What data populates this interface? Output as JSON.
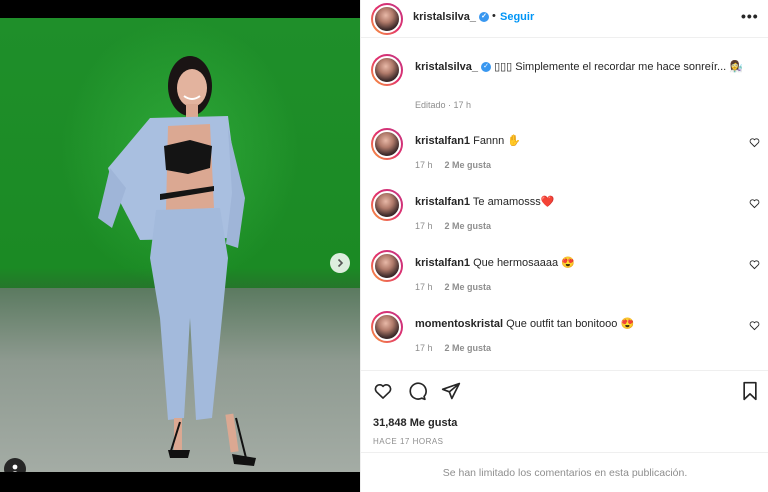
{
  "post": {
    "username": "kristalsilva_",
    "follow_label": "Seguir",
    "dot": "•",
    "more_label": "•••",
    "caption": "▯▯▯ Simplemente el recordar me hace sonreír... 👩‍🔬",
    "edited_meta": "Editado · 17 h"
  },
  "comments": [
    {
      "user": "kristalfan1",
      "text": "Fannn ✋",
      "time": "17 h",
      "likes": "2 Me gusta"
    },
    {
      "user": "kristalfan1",
      "text": "Te amamosss❤️",
      "time": "17 h",
      "likes": "2 Me gusta"
    },
    {
      "user": "kristalfan1",
      "text": "Que hermosaaaa 😍",
      "time": "17 h",
      "likes": "2 Me gusta"
    },
    {
      "user": "momentoskristal",
      "text": "Que outfit tan bonitooo 😍",
      "time": "17 h",
      "likes": "2 Me gusta"
    }
  ],
  "stats": {
    "likes": "31,848 Me gusta",
    "when": "HACE 17 HORAS"
  },
  "footer": {
    "limited": "Se han limitado los comentarios en esta publicación."
  },
  "carousel": {
    "current": 1,
    "total": 3
  },
  "colors": {
    "accent": "#0095f6",
    "verified": "#3897f0",
    "green_screen": "#1b8a24"
  }
}
